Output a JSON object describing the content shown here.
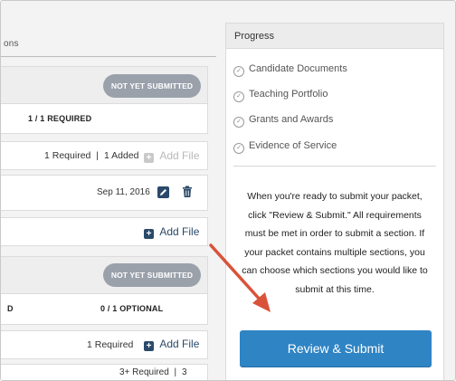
{
  "left": {
    "tabs_fragment": "ons",
    "section1": {
      "status_badge": "NOT YET SUBMITTED",
      "requirement": "1 / 1 REQUIRED",
      "row_required": "1 Required",
      "row_sep": "|",
      "row_added": "1 Added",
      "add_file_disabled": "Add File",
      "file_date": "Sep 11, 2016",
      "add_file": "Add File"
    },
    "section2": {
      "status_badge": "NOT YET SUBMITTED",
      "left_fragment": "D",
      "requirement": "0 / 1 OPTIONAL",
      "row_required": "1 Required",
      "add_file": "Add File",
      "bottom_fragment": "3+ Required",
      "bottom_sep": "|",
      "bottom_count": "3"
    }
  },
  "progress": {
    "title": "Progress",
    "items": [
      {
        "label": "Candidate Documents"
      },
      {
        "label": "Teaching Portfolio"
      },
      {
        "label": "Grants and Awards"
      },
      {
        "label": "Evidence of Service"
      }
    ],
    "instructions": "When you're ready to submit your packet, click \"Review & Submit.\" All requirements must be met in order to submit a section. If your packet contains multiple sections, you can choose which sections you would like to submit at this time.",
    "submit_label": "Review & Submit"
  },
  "colors": {
    "accent": "#2f84c4",
    "badge": "#9aa1ab",
    "arrow": "#d9533a"
  },
  "icons": [
    "check-circle-icon",
    "plus-icon",
    "edit-icon",
    "trash-icon",
    "arrow-annotation"
  ]
}
